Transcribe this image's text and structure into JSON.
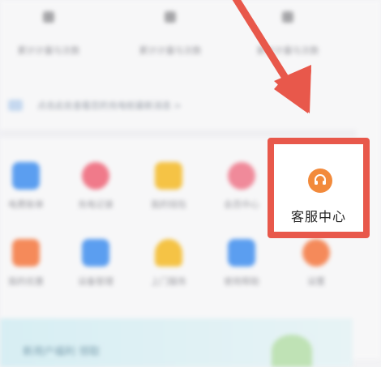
{
  "top_row": [
    {
      "label": "累计计量与次数"
    },
    {
      "label": "累计计量与次数"
    },
    {
      "label": "累计计量与次数"
    }
  ],
  "notice": {
    "text": "点击此处查看您的充电桩最新消息 >",
    "more": ""
  },
  "grid_row1": [
    {
      "label": "电费账单",
      "icon": "wallet-icon",
      "color": "#5b9ef0"
    },
    {
      "label": "充电记录",
      "icon": "charge-icon",
      "color": "#f07a8a"
    },
    {
      "label": "我的钱包",
      "icon": "coin-icon",
      "color": "#f5c345"
    },
    {
      "label": "会员中心",
      "icon": "crown-icon",
      "color": "#f08a9a"
    }
  ],
  "grid_row2": [
    {
      "label": "我的优惠",
      "icon": "gift-icon",
      "color": "#f58a5a"
    },
    {
      "label": "设备管理",
      "icon": "device-icon",
      "color": "#5b9ef0"
    },
    {
      "label": "上门服务",
      "icon": "service-icon",
      "color": "#f5c345"
    },
    {
      "label": "使用帮助",
      "icon": "help-icon",
      "color": "#5b9ef0"
    },
    {
      "label": "设置",
      "icon": "settings-icon",
      "color": "#f58a5a"
    }
  ],
  "banner": {
    "text": "新用户福利 领取"
  },
  "highlight": {
    "label": "客服中心",
    "icon": "headset-icon",
    "border_color": "#e8584b",
    "icon_color": "#f28a3b"
  }
}
